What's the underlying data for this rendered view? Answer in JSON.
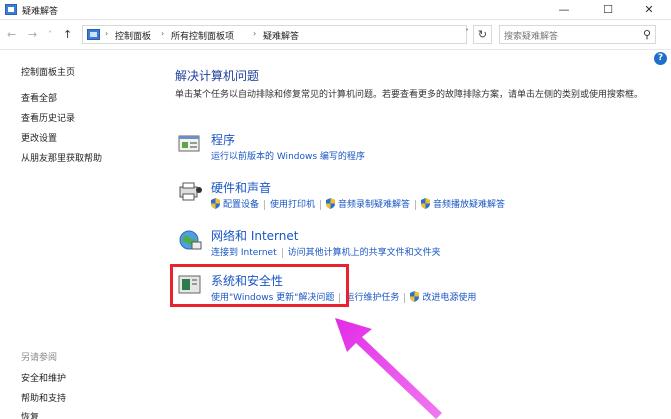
{
  "window": {
    "title": "疑难解答",
    "minimize": "—",
    "maximize": "☐",
    "close": "✕"
  },
  "nav": {
    "back": "←",
    "forward": "→",
    "recent": "˅",
    "up": "↑",
    "breadcrumbs": [
      "控制面板",
      "所有控制面板项",
      "疑难解答"
    ],
    "refresh": "↻",
    "search_placeholder": "搜索疑难解答"
  },
  "sidebar": {
    "items": [
      {
        "label": "控制面板主页"
      },
      {
        "label": "查看全部"
      },
      {
        "label": "查看历史记录"
      },
      {
        "label": "更改设置"
      },
      {
        "label": "从朋友那里获取帮助"
      }
    ],
    "see_also_label": "另请参阅",
    "see_also": [
      {
        "label": "安全和维护"
      },
      {
        "label": "帮助和支持"
      },
      {
        "label": "恢复"
      }
    ]
  },
  "main": {
    "title": "解决计算机问题",
    "description": "单击某个任务以自动排除和修复常见的计算机问题。若要查看更多的故障排除方案，请单击左侧的类别或使用搜索框。",
    "categories": [
      {
        "title": "程序",
        "icon": "programs-icon",
        "links": [
          "运行以前版本的 Windows 编写的程序"
        ]
      },
      {
        "title": "硬件和声音",
        "icon": "hardware-sound-icon",
        "links": [
          "配置设备",
          "使用打印机",
          "音频录制疑难解答",
          "音频播放疑难解答"
        ]
      },
      {
        "title": "网络和 Internet",
        "icon": "network-icon",
        "links": [
          "连接到 Internet",
          "访问其他计算机上的共享文件和文件夹"
        ]
      },
      {
        "title": "系统和安全性",
        "icon": "system-security-icon",
        "links": [
          "使用\"Windows 更新\"解决问题",
          "运行维护任务",
          "改进电源使用"
        ]
      }
    ]
  },
  "colors": {
    "link": "#1a56c4",
    "heading": "#1e3f9a",
    "highlight": "#e8232f",
    "arrow": "#e22be6"
  }
}
